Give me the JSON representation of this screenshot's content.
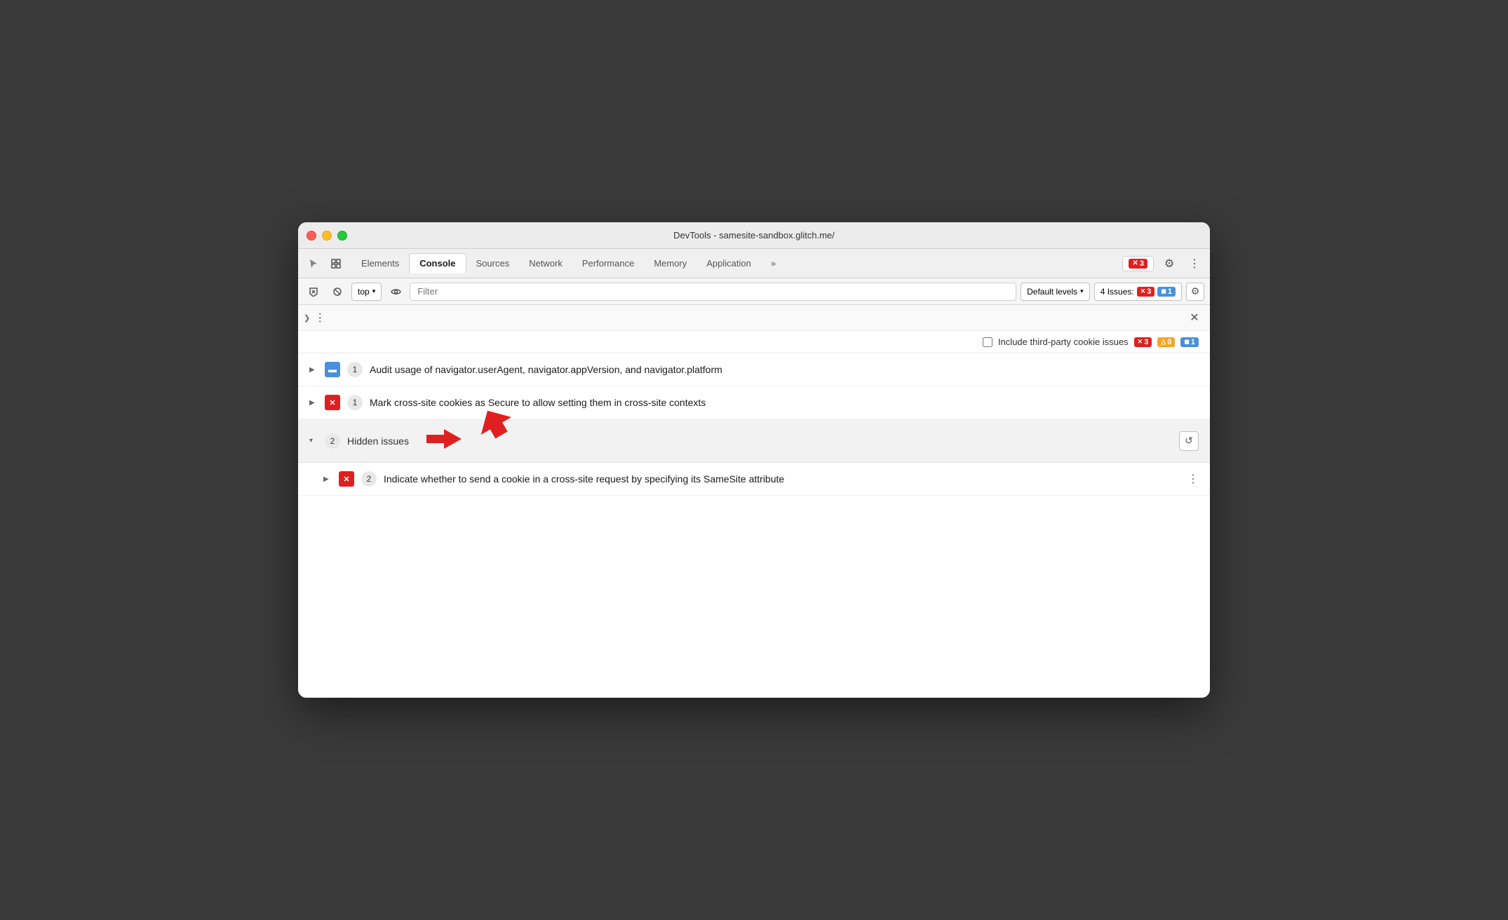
{
  "window": {
    "title": "DevTools - samesite-sandbox.glitch.me/"
  },
  "tabs": [
    {
      "id": "elements",
      "label": "Elements",
      "active": false
    },
    {
      "id": "console",
      "label": "Console",
      "active": true
    },
    {
      "id": "sources",
      "label": "Sources",
      "active": false
    },
    {
      "id": "network",
      "label": "Network",
      "active": false
    },
    {
      "id": "performance",
      "label": "Performance",
      "active": false
    },
    {
      "id": "memory",
      "label": "Memory",
      "active": false
    },
    {
      "id": "application",
      "label": "Application",
      "active": false
    }
  ],
  "tab_bar": {
    "error_count": "3",
    "more_label": "»"
  },
  "toolbar": {
    "top_label": "top",
    "filter_placeholder": "Filter",
    "default_levels_label": "Default levels",
    "issues_label": "4 Issues:",
    "issues_red_count": "3",
    "issues_blue_count": "1"
  },
  "console_panel": {
    "include_third_party_label": "Include third-party cookie issues",
    "badge_red_count": "3",
    "badge_orange_count": "0",
    "badge_blue_count": "1"
  },
  "issues": [
    {
      "id": "issue1",
      "type": "info",
      "count": "1",
      "text": "Audit usage of navigator.userAgent, navigator.appVersion, and navigator.platform",
      "expanded": false
    },
    {
      "id": "issue2",
      "type": "error",
      "count": "1",
      "text": "Mark cross-site cookies as Secure to allow setting them in cross-site contexts",
      "expanded": false
    }
  ],
  "hidden_issues": {
    "count": "2",
    "label": "Hidden issues"
  },
  "nested_issues": [
    {
      "id": "nested1",
      "type": "error",
      "count": "2",
      "text": "Indicate whether to send a cookie in a cross-site request by specifying its SameSite attribute",
      "expanded": false
    }
  ],
  "icons": {
    "cursor": "⬚",
    "layers": "⧉",
    "play": "▶",
    "ban": "⊘",
    "eye": "◉",
    "chevron_down": "▾",
    "chevron_right": "▶",
    "chevron_left": "❯",
    "gear": "⚙",
    "more_vert": "⋮",
    "close": "✕",
    "refresh": "↺",
    "x_mark": "✕",
    "error_x": "✕",
    "info_i": "i",
    "message": "▬"
  },
  "colors": {
    "red_badge": "#e02020",
    "blue_badge": "#4a90d9",
    "orange_badge": "#f5a623",
    "active_tab": "#ffffff",
    "bg": "#f5f5f5"
  }
}
